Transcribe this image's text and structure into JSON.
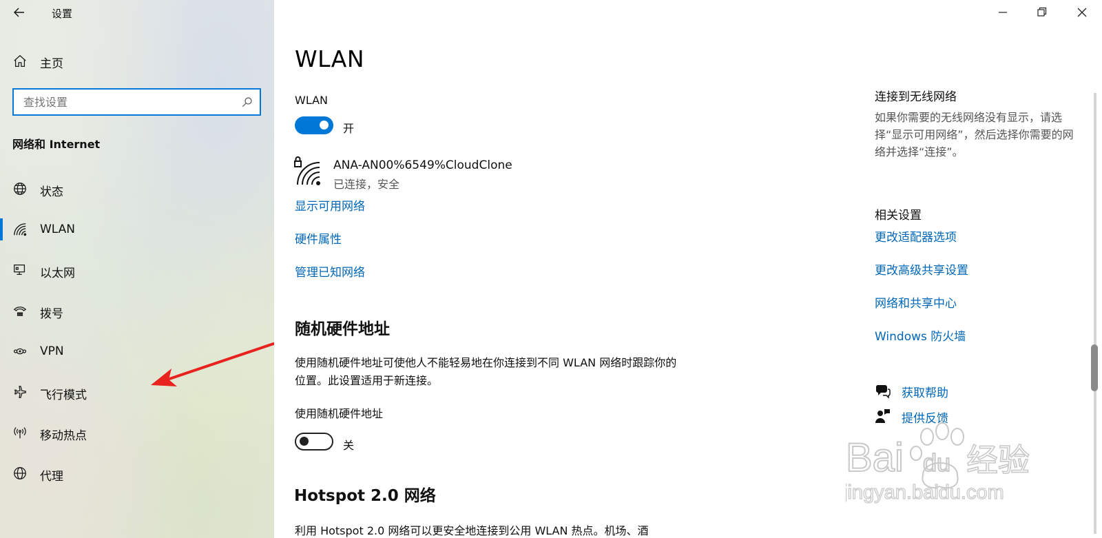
{
  "window": {
    "title": "设置"
  },
  "sidebar": {
    "home_label": "主页",
    "search_placeholder": "查找设置",
    "section_title": "网络和 Internet",
    "items": [
      {
        "label": "状态",
        "icon": "globe-status-icon"
      },
      {
        "label": "WLAN",
        "icon": "wifi-icon",
        "active": true
      },
      {
        "label": "以太网",
        "icon": "ethernet-icon"
      },
      {
        "label": "拨号",
        "icon": "dialup-icon"
      },
      {
        "label": "VPN",
        "icon": "vpn-icon"
      },
      {
        "label": "飞行模式",
        "icon": "airplane-icon"
      },
      {
        "label": "移动热点",
        "icon": "hotspot-icon"
      },
      {
        "label": "代理",
        "icon": "proxy-globe-icon"
      }
    ]
  },
  "main": {
    "title": "WLAN",
    "wlan_toggle": {
      "label": "WLAN",
      "state": "开",
      "on": true
    },
    "network": {
      "name": "ANA-AN00%6549%CloudClone",
      "status": "已连接，安全"
    },
    "links": [
      "显示可用网络",
      "硬件属性",
      "管理已知网络"
    ],
    "random_mac": {
      "heading": "随机硬件地址",
      "description": "使用随机硬件地址可使他人不能轻易地在你连接到不同 WLAN 网络时跟踪你的位置。此设置适用于新连接。",
      "toggle_label": "使用随机硬件地址",
      "toggle_state": "关",
      "on": false
    },
    "hotspot": {
      "heading": "Hotspot 2.0 网络",
      "description": "利用 Hotspot 2.0 网络可以更安全地连接到公用 WLAN 热点。机场、酒"
    }
  },
  "right": {
    "connect_heading": "连接到无线网络",
    "connect_text": "如果你需要的无线网络没有显示，请选择“显示可用网络”，然后选择你需要的网络并选择“连接”。",
    "related_heading": "相关设置",
    "related_links": [
      "更改适配器选项",
      "更改高级共享设置",
      "网络和共享中心",
      "Windows 防火墙"
    ],
    "help_label": "获取帮助",
    "feedback_label": "提供反馈"
  },
  "watermark": {
    "brand_text": "Bai",
    "brand_text_2": "du",
    "brand_cn": "经验",
    "url": "jingyan.baidu.com"
  },
  "colors": {
    "accent": "#0078d7",
    "link": "#0067b8",
    "annotation_arrow": "#e8231f"
  }
}
